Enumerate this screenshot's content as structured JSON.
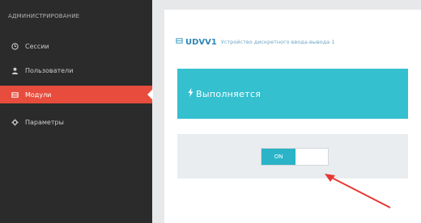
{
  "sidebar": {
    "header": "АДМИНИСТРИРОВАНИЕ",
    "items": [
      {
        "label": "Сессии",
        "icon": "clock-icon",
        "active": false
      },
      {
        "label": "Пользователи",
        "icon": "user-icon",
        "active": false
      },
      {
        "label": "Модули",
        "icon": "module-icon",
        "active": true
      },
      {
        "label": "Параметры",
        "icon": "gear-icon",
        "active": false
      }
    ]
  },
  "module": {
    "icon": "module-icon",
    "name": "UDVV1",
    "description": "Устройство дискретного ввода-вывода 1",
    "status_text": "Выполняется",
    "status_icon": "bolt-icon",
    "switch": {
      "on_label": "ON",
      "state": "on"
    }
  },
  "colors": {
    "sidebar_bg": "#2b2b2b",
    "active_item": "#e74c3c",
    "status_bg": "#35c0cf",
    "switch_on": "#2bb3c7",
    "annotation_arrow": "#e53935"
  }
}
